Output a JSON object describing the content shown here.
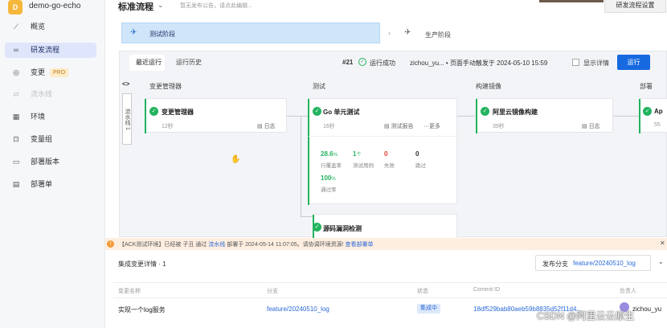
{
  "app": {
    "logo_letter": "D",
    "name": "demo-go-echo"
  },
  "sidebar": {
    "items": [
      {
        "label": "概览",
        "icon": "chart-line-icon"
      },
      {
        "label": "研发流程",
        "icon": "infinity-icon",
        "active": true
      },
      {
        "label": "变更",
        "icon": "branch-icon",
        "badge": "PRO"
      },
      {
        "label": "流水线",
        "icon": "pipeline-icon",
        "disabled": true
      },
      {
        "label": "环境",
        "icon": "grid-icon"
      },
      {
        "label": "变量组",
        "icon": "variables-icon"
      },
      {
        "label": "部署版本",
        "icon": "package-icon"
      },
      {
        "label": "部署单",
        "icon": "document-icon"
      }
    ]
  },
  "header": {
    "title": "标准流程",
    "notice": "暂无发布公告，请点此编辑...",
    "settings_button": "研发流程设置"
  },
  "stages": [
    {
      "label": "测试阶段",
      "active": true
    },
    {
      "label": "生产阶段",
      "active": false
    }
  ],
  "run_panel": {
    "tabs": [
      "最近运行",
      "运行历史"
    ],
    "run_number": "#21",
    "run_status": "运行成功",
    "run_by": "zichou_yu... • 页面手动触发于 2024-05-10 15:59",
    "show_detail_label": "显示详情",
    "run_button": "运行",
    "lane_label": "流水线 1",
    "columns": [
      "变更管理器",
      "测试",
      "构建镜像",
      "部署"
    ],
    "jobs": {
      "change_manager": {
        "name": "变更管理器",
        "time": "12秒",
        "log": "日志"
      },
      "go_test": {
        "name": "Go 单元测试",
        "time": "16秒",
        "report": "测试报告",
        "more": "更多",
        "stats": [
          {
            "value": "28.6",
            "unit": "%",
            "label": "行覆盖率",
            "color": "#22b35e"
          },
          {
            "value": "1",
            "unit": "个",
            "label": "测试用例",
            "color": "#22b35e"
          },
          {
            "value": "0",
            "unit": "",
            "label": "失败",
            "color": "#e53935"
          },
          {
            "value": "0",
            "unit": "",
            "label": "跳过",
            "color": "#333333"
          },
          {
            "value": "100",
            "unit": "%",
            "label": "通过率",
            "color": "#22b35e"
          }
        ]
      },
      "code_scan": {
        "name": "源码漏洞检测"
      },
      "build_image": {
        "name": "阿里云镜像构建",
        "time": "39秒",
        "log": "日志"
      },
      "deploy": {
        "name": "Ap",
        "time": "55"
      }
    }
  },
  "warning": {
    "prefix": "【ACK测试环境】已经被 子丑 通过",
    "link1": "流水线",
    "middle": "部署于 2024-05-14 11:07:05。请协调环境资源!",
    "link2": "查看部署单"
  },
  "integration": {
    "title": "集成变更详情 · 1",
    "branch_label": "发布分支",
    "branch_value": "feature/20240510_log",
    "columns": [
      "变更名称",
      "分支",
      "状态",
      "Commit ID",
      "负责人"
    ],
    "rows": [
      {
        "name": "实现一个log服务",
        "branch": "feature/20240510_log",
        "status": "集成中",
        "commit": "18df529bab80aeb59b8835d52f11d4...",
        "owner": "zichou_yu"
      }
    ]
  },
  "watermark": "CSDN @阿里云云原生",
  "colors": {
    "accent": "#1769e0",
    "success": "#22b35e",
    "active_nav": "#dfe5fb",
    "stage_active": "#cfe6fa"
  }
}
